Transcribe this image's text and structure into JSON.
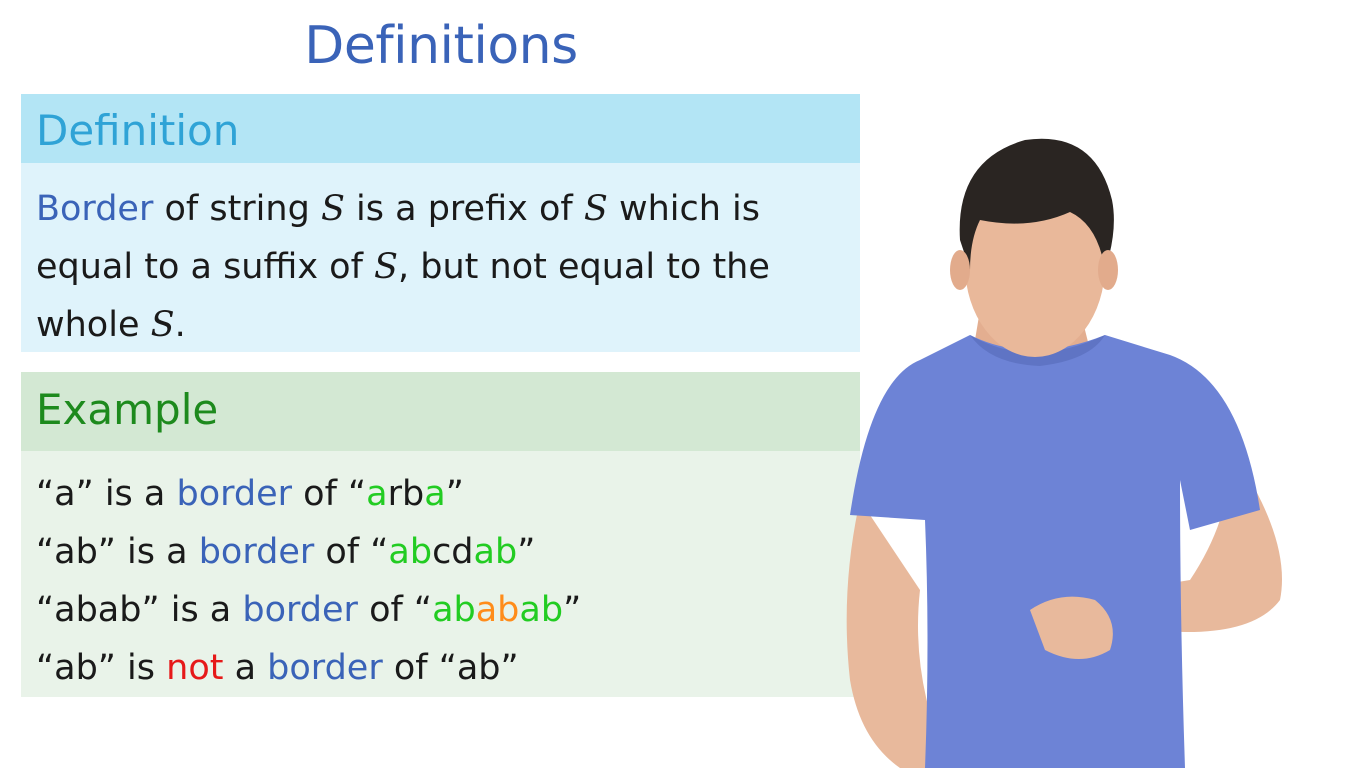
{
  "slide": {
    "title": "Definitions"
  },
  "definition": {
    "heading": "Definition",
    "term": "Border",
    "t1": " of string ",
    "s1": "S",
    "t2": " is a prefix of ",
    "s2": "S",
    "t3": " which is equal to a suffix of ",
    "s3": "S",
    "t4": ", but not equal to the whole ",
    "s4": "S",
    "t5": "."
  },
  "example": {
    "heading": "Example",
    "lines": [
      {
        "q": "“a” is a ",
        "b": "border",
        "of": " of “",
        "g1": "a",
        "p": "rb",
        "g2": "a",
        "end": "”"
      },
      {
        "q": "“ab” is a ",
        "b": "border",
        "of": " of “",
        "g1": "ab",
        "p": "cd",
        "g2": "ab",
        "end": "”"
      },
      {
        "q": "“abab” is a ",
        "b": "border",
        "of": " of “",
        "g1": "ab",
        "o": "ab",
        "g2": "ab",
        "end": "”"
      },
      {
        "q": "“ab” is ",
        "not": "not",
        "a": " a ",
        "b": "border",
        "of": " of “ab”"
      }
    ]
  },
  "colors": {
    "title": "#3a63b8",
    "definition_header": "#b3e5f5",
    "definition_body": "#dff3fb",
    "example_header": "#d3e8d3",
    "example_body": "#e9f3e9",
    "highlight_green": "#22cc22",
    "highlight_orange": "#ff8c1a",
    "negation_red": "#e61919",
    "shirt": "#6d83d6"
  }
}
